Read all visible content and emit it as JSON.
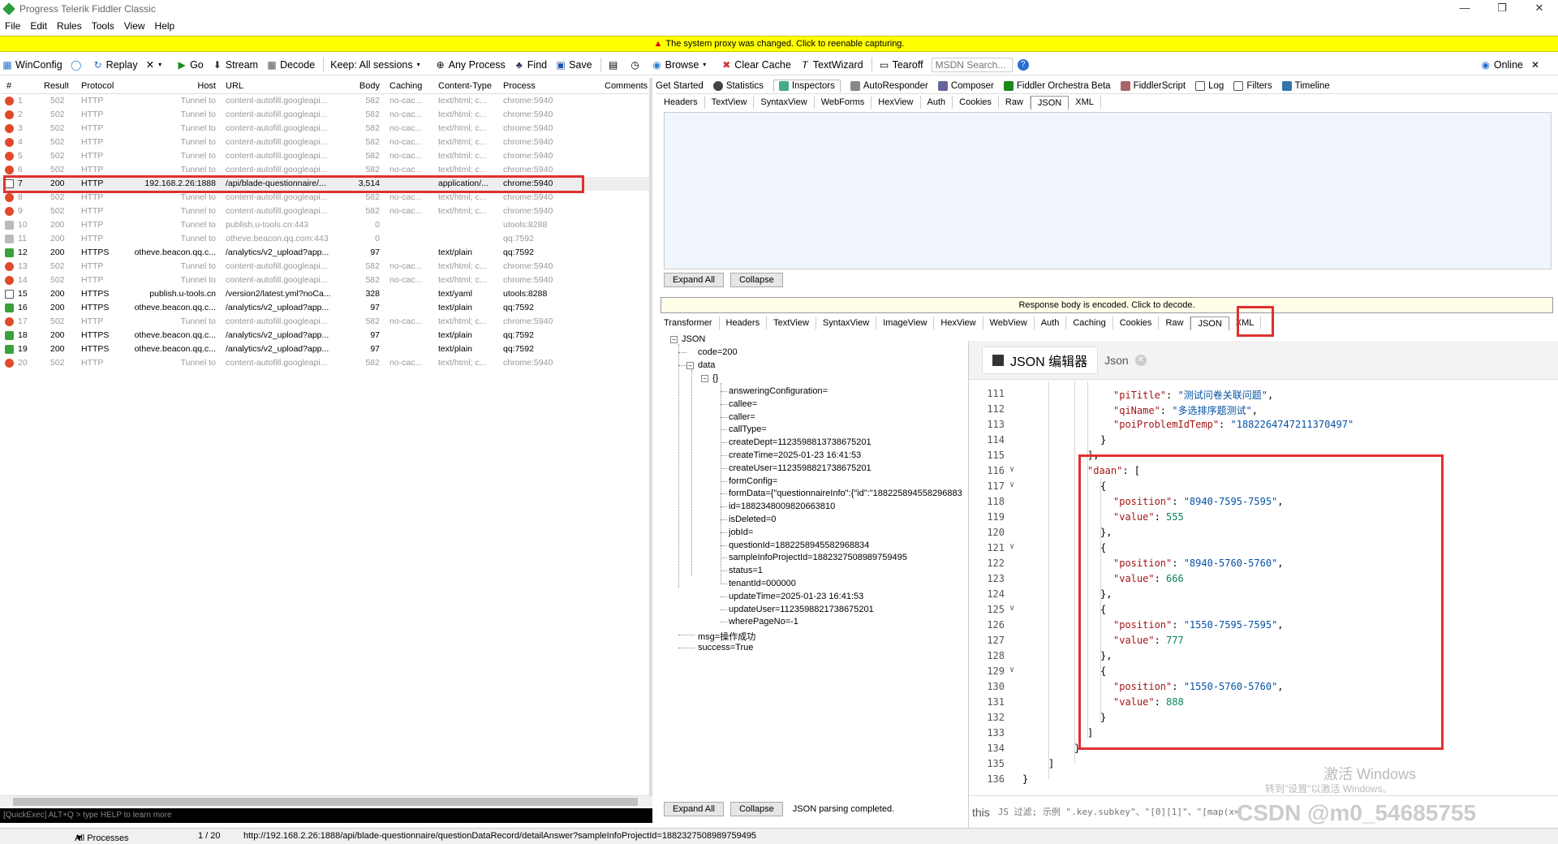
{
  "window": {
    "title": "Progress Telerik Fiddler Classic",
    "min": "—",
    "max": "❐",
    "close": "✕"
  },
  "menu": [
    "File",
    "Edit",
    "Rules",
    "Tools",
    "View",
    "Help"
  ],
  "warning": "The system proxy was changed. Click to reenable capturing.",
  "toolbar": {
    "winconfig": "WinConfig",
    "replay": "Replay",
    "remove": "✕",
    "go": "Go",
    "stream": "Stream",
    "decode": "Decode",
    "keep": "Keep: All sessions",
    "any_process": "Any Process",
    "find": "Find",
    "save": "Save",
    "browse": "Browse",
    "clear_cache": "Clear Cache",
    "textwizard": "TextWizard",
    "tearoff": "Tearoff",
    "msdn_placeholder": "MSDN Search...",
    "online": "Online"
  },
  "sessions": {
    "columns": [
      "#",
      "Result",
      "Protocol",
      "Host",
      "URL",
      "Body",
      "Caching",
      "Content-Type",
      "Process",
      "Comments"
    ],
    "rows": [
      {
        "id": "1",
        "result": "502",
        "proto": "HTTP",
        "host": "Tunnel to",
        "url": "content-autofill.googleapi...",
        "body": "582",
        "cache": "no-cac...",
        "ctype": "text/html; c...",
        "proc": "chrome:5940",
        "icon": "error"
      },
      {
        "id": "2",
        "result": "502",
        "proto": "HTTP",
        "host": "Tunnel to",
        "url": "content-autofill.googleapi...",
        "body": "582",
        "cache": "no-cac...",
        "ctype": "text/html; c...",
        "proc": "chrome:5940",
        "icon": "error"
      },
      {
        "id": "3",
        "result": "502",
        "proto": "HTTP",
        "host": "Tunnel to",
        "url": "content-autofill.googleapi...",
        "body": "582",
        "cache": "no-cac...",
        "ctype": "text/html; c...",
        "proc": "chrome:5940",
        "icon": "error"
      },
      {
        "id": "4",
        "result": "502",
        "proto": "HTTP",
        "host": "Tunnel to",
        "url": "content-autofill.googleapi...",
        "body": "582",
        "cache": "no-cac...",
        "ctype": "text/html; c...",
        "proc": "chrome:5940",
        "icon": "error"
      },
      {
        "id": "5",
        "result": "502",
        "proto": "HTTP",
        "host": "Tunnel to",
        "url": "content-autofill.googleapi...",
        "body": "582",
        "cache": "no-cac...",
        "ctype": "text/html; c...",
        "proc": "chrome:5940",
        "icon": "error"
      },
      {
        "id": "6",
        "result": "502",
        "proto": "HTTP",
        "host": "Tunnel to",
        "url": "content-autofill.googleapi...",
        "body": "582",
        "cache": "no-cac...",
        "ctype": "text/html; c...",
        "proc": "chrome:5940",
        "icon": "error"
      },
      {
        "id": "7",
        "result": "200",
        "proto": "HTTP",
        "host": "192.168.2.26:1888",
        "url": "/api/blade-questionnaire/...",
        "body": "3,514",
        "cache": "",
        "ctype": "application/...",
        "proc": "chrome:5940",
        "icon": "doc",
        "dark": true,
        "sel": true
      },
      {
        "id": "8",
        "result": "502",
        "proto": "HTTP",
        "host": "Tunnel to",
        "url": "content-autofill.googleapi...",
        "body": "582",
        "cache": "no-cac...",
        "ctype": "text/html; c...",
        "proc": "chrome:5940",
        "icon": "error"
      },
      {
        "id": "9",
        "result": "502",
        "proto": "HTTP",
        "host": "Tunnel to",
        "url": "content-autofill.googleapi...",
        "body": "582",
        "cache": "no-cac...",
        "ctype": "text/html; c...",
        "proc": "chrome:5940",
        "icon": "error"
      },
      {
        "id": "10",
        "result": "200",
        "proto": "HTTP",
        "host": "Tunnel to",
        "url": "publish.u-tools.cn:443",
        "body": "0",
        "cache": "",
        "ctype": "",
        "proc": "utools:8288",
        "icon": "lock"
      },
      {
        "id": "11",
        "result": "200",
        "proto": "HTTP",
        "host": "Tunnel to",
        "url": "otheve.beacon.qq.com:443",
        "body": "0",
        "cache": "",
        "ctype": "",
        "proc": "qq:7592",
        "icon": "lock"
      },
      {
        "id": "12",
        "result": "200",
        "proto": "HTTPS",
        "host": "otheve.beacon.qq.c...",
        "url": "/analytics/v2_upload?app...",
        "body": "97",
        "cache": "",
        "ctype": "text/plain",
        "proc": "qq:7592",
        "icon": "green",
        "dark": true
      },
      {
        "id": "13",
        "result": "502",
        "proto": "HTTP",
        "host": "Tunnel to",
        "url": "content-autofill.googleapi...",
        "body": "582",
        "cache": "no-cac...",
        "ctype": "text/html; c...",
        "proc": "chrome:5940",
        "icon": "error"
      },
      {
        "id": "14",
        "result": "502",
        "proto": "HTTP",
        "host": "Tunnel to",
        "url": "content-autofill.googleapi...",
        "body": "582",
        "cache": "no-cac...",
        "ctype": "text/html; c...",
        "proc": "chrome:5940",
        "icon": "error"
      },
      {
        "id": "15",
        "result": "200",
        "proto": "HTTPS",
        "host": "publish.u-tools.cn",
        "url": "/version2/latest.yml?noCa...",
        "body": "328",
        "cache": "",
        "ctype": "text/yaml",
        "proc": "utools:8288",
        "icon": "doc",
        "dark": true
      },
      {
        "id": "16",
        "result": "200",
        "proto": "HTTPS",
        "host": "otheve.beacon.qq.c...",
        "url": "/analytics/v2_upload?app...",
        "body": "97",
        "cache": "",
        "ctype": "text/plain",
        "proc": "qq:7592",
        "icon": "green",
        "dark": true
      },
      {
        "id": "17",
        "result": "502",
        "proto": "HTTP",
        "host": "Tunnel to",
        "url": "content-autofill.googleapi...",
        "body": "582",
        "cache": "no-cac...",
        "ctype": "text/html; c...",
        "proc": "chrome:5940",
        "icon": "error"
      },
      {
        "id": "18",
        "result": "200",
        "proto": "HTTPS",
        "host": "otheve.beacon.qq.c...",
        "url": "/analytics/v2_upload?app...",
        "body": "97",
        "cache": "",
        "ctype": "text/plain",
        "proc": "qq:7592",
        "icon": "green",
        "dark": true
      },
      {
        "id": "19",
        "result": "200",
        "proto": "HTTPS",
        "host": "otheve.beacon.qq.c...",
        "url": "/analytics/v2_upload?app...",
        "body": "97",
        "cache": "",
        "ctype": "text/plain",
        "proc": "qq:7592",
        "icon": "green",
        "dark": true
      },
      {
        "id": "20",
        "result": "502",
        "proto": "HTTP",
        "host": "Tunnel to",
        "url": "content-autofill.googleapi...",
        "body": "582",
        "cache": "no-cac...",
        "ctype": "text/html; c...",
        "proc": "chrome:5940",
        "icon": "error"
      }
    ]
  },
  "quickexec": "[QuickExec] ALT+Q > type HELP to learn more",
  "status": {
    "processes": "All Processes",
    "count": "1 / 20",
    "url": "http://192.168.2.26:1888/api/blade-questionnaire/questionDataRecord/detailAnswer?sampleInfoProjectId=1882327508989759495"
  },
  "right_tabs": [
    "Get Started",
    "Statistics",
    "Inspectors",
    "AutoResponder",
    "Composer",
    "Fiddler Orchestra Beta",
    "FiddlerScript",
    "Log",
    "Filters",
    "Timeline"
  ],
  "request_subtabs": [
    "Headers",
    "TextView",
    "SyntaxView",
    "WebForms",
    "HexView",
    "Auth",
    "Cookies",
    "Raw",
    "JSON",
    "XML"
  ],
  "buttons": {
    "expand_all": "Expand All",
    "collapse": "Collapse",
    "parse_status": "JSON parsing completed."
  },
  "response_encoded": "Response body is encoded. Click to decode.",
  "response_subtabs": [
    "Transformer",
    "Headers",
    "TextView",
    "SyntaxView",
    "ImageView",
    "HexView",
    "WebView",
    "Auth",
    "Caching",
    "Cookies",
    "Raw",
    "JSON",
    "XML"
  ],
  "tree": {
    "root": "JSON",
    "code": "code=200",
    "data": "data",
    "obj": "{}",
    "fields": [
      "answeringConfiguration=",
      "callee=",
      "caller=",
      "callType=",
      "createDept=1123598813738675201",
      "createTime=2025-01-23 16:41:53",
      "createUser=1123598821738675201",
      "formConfig=",
      "formData={\"questionnaireInfo\":{\"id\":\"188225894558296883",
      "id=1882348009820663810",
      "isDeleted=0",
      "jobId=",
      "questionId=1882258945582968834",
      "sampleInfoProjectId=1882327508989759495",
      "status=1",
      "tenantId=000000",
      "updateTime=2025-01-23 16:41:53",
      "updateUser=1123598821738675201",
      "wherePageNo=-1"
    ],
    "msg": "msg=操作成功",
    "success": "success=True"
  },
  "editor": {
    "tab1": "JSON 编辑器",
    "tab2": "Json",
    "lines": [
      {
        "n": "111",
        "f": "",
        "i": 7,
        "parts": [
          [
            "k",
            "\"piTitle\""
          ],
          [
            "p",
            ": "
          ],
          [
            "s",
            "\"测试问卷关联问题\""
          ],
          [
            "p",
            ","
          ]
        ]
      },
      {
        "n": "112",
        "f": "",
        "i": 7,
        "parts": [
          [
            "k",
            "\"qiName\""
          ],
          [
            "p",
            ": "
          ],
          [
            "s",
            "\"多选排序题测试\""
          ],
          [
            "p",
            ","
          ]
        ]
      },
      {
        "n": "113",
        "f": "",
        "i": 7,
        "parts": [
          [
            "k",
            "\"poiProblemIdTemp\""
          ],
          [
            "p",
            ": "
          ],
          [
            "s",
            "\"1882264747211370497\""
          ]
        ]
      },
      {
        "n": "114",
        "f": "",
        "i": 6,
        "parts": [
          [
            "p",
            "}"
          ]
        ]
      },
      {
        "n": "115",
        "f": "",
        "i": 5,
        "parts": [
          [
            "p",
            "],"
          ]
        ]
      },
      {
        "n": "116",
        "f": "∨",
        "i": 5,
        "parts": [
          [
            "k",
            "\"daan\""
          ],
          [
            "p",
            ": ["
          ]
        ]
      },
      {
        "n": "117",
        "f": "∨",
        "i": 6,
        "parts": [
          [
            "p",
            "{"
          ]
        ]
      },
      {
        "n": "118",
        "f": "",
        "i": 7,
        "parts": [
          [
            "k",
            "\"position\""
          ],
          [
            "p",
            ": "
          ],
          [
            "s",
            "\"8940-7595-7595\""
          ],
          [
            "p",
            ","
          ]
        ]
      },
      {
        "n": "119",
        "f": "",
        "i": 7,
        "parts": [
          [
            "k",
            "\"value\""
          ],
          [
            "p",
            ": "
          ],
          [
            "n",
            "555"
          ]
        ]
      },
      {
        "n": "120",
        "f": "",
        "i": 6,
        "parts": [
          [
            "p",
            "},"
          ]
        ]
      },
      {
        "n": "121",
        "f": "∨",
        "i": 6,
        "parts": [
          [
            "p",
            "{"
          ]
        ]
      },
      {
        "n": "122",
        "f": "",
        "i": 7,
        "parts": [
          [
            "k",
            "\"position\""
          ],
          [
            "p",
            ": "
          ],
          [
            "s",
            "\"8940-5760-5760\""
          ],
          [
            "p",
            ","
          ]
        ]
      },
      {
        "n": "123",
        "f": "",
        "i": 7,
        "parts": [
          [
            "k",
            "\"value\""
          ],
          [
            "p",
            ": "
          ],
          [
            "n",
            "666"
          ]
        ]
      },
      {
        "n": "124",
        "f": "",
        "i": 6,
        "parts": [
          [
            "p",
            "},"
          ]
        ]
      },
      {
        "n": "125",
        "f": "∨",
        "i": 6,
        "parts": [
          [
            "p",
            "{"
          ]
        ]
      },
      {
        "n": "126",
        "f": "",
        "i": 7,
        "parts": [
          [
            "k",
            "\"position\""
          ],
          [
            "p",
            ": "
          ],
          [
            "s",
            "\"1550-7595-7595\""
          ],
          [
            "p",
            ","
          ]
        ]
      },
      {
        "n": "127",
        "f": "",
        "i": 7,
        "parts": [
          [
            "k",
            "\"value\""
          ],
          [
            "p",
            ": "
          ],
          [
            "n",
            "777"
          ]
        ]
      },
      {
        "n": "128",
        "f": "",
        "i": 6,
        "parts": [
          [
            "p",
            "},"
          ]
        ]
      },
      {
        "n": "129",
        "f": "∨",
        "i": 6,
        "parts": [
          [
            "p",
            "{"
          ]
        ]
      },
      {
        "n": "130",
        "f": "",
        "i": 7,
        "parts": [
          [
            "k",
            "\"position\""
          ],
          [
            "p",
            ": "
          ],
          [
            "s",
            "\"1550-5760-5760\""
          ],
          [
            "p",
            ","
          ]
        ]
      },
      {
        "n": "131",
        "f": "",
        "i": 7,
        "parts": [
          [
            "k",
            "\"value\""
          ],
          [
            "p",
            ": "
          ],
          [
            "n",
            "888"
          ]
        ]
      },
      {
        "n": "132",
        "f": "",
        "i": 6,
        "parts": [
          [
            "p",
            "}"
          ]
        ]
      },
      {
        "n": "133",
        "f": "",
        "i": 5,
        "parts": [
          [
            "p",
            "]"
          ]
        ]
      },
      {
        "n": "134",
        "f": "",
        "i": 4,
        "parts": [
          [
            "p",
            "}"
          ]
        ]
      },
      {
        "n": "135",
        "f": "",
        "i": 2,
        "parts": [
          [
            "p",
            "]"
          ]
        ]
      },
      {
        "n": "136",
        "f": "",
        "i": 0,
        "parts": [
          [
            "p",
            "}"
          ]
        ]
      }
    ],
    "filter_prefix": "this",
    "filter_hint": "JS 过滤; 示例 \".key.subkey\"、\"[0][1]\"、\"[map(x=>x.val)\"",
    "watermark_title": "激活 Windows",
    "watermark_sub": "转到\"设置\"以激活 Windows。",
    "csdn": "CSDN @m0_54685755"
  }
}
